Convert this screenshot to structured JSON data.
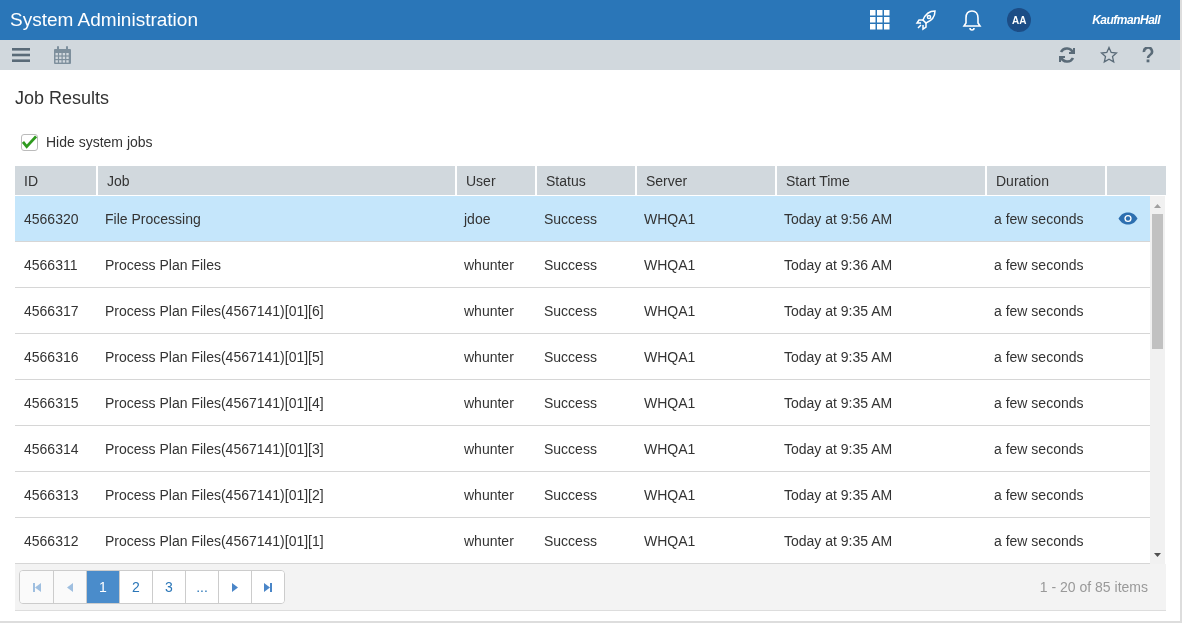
{
  "header": {
    "title": "System Administration",
    "avatar": "AA",
    "brand": "KaufmanHall"
  },
  "page": {
    "title": "Job Results",
    "hide_system_jobs": {
      "label": "Hide system jobs",
      "checked": true
    }
  },
  "table": {
    "columns": [
      "ID",
      "Job",
      "User",
      "Status",
      "Server",
      "Start Time",
      "Duration"
    ],
    "rows": [
      {
        "id": "4566320",
        "job": "File Processing",
        "user": "jdoe",
        "status": "Success",
        "server": "WHQA1",
        "start": "Today at 9:56 AM",
        "duration": "a few seconds",
        "selected": true
      },
      {
        "id": "4566311",
        "job": "Process Plan Files",
        "user": "whunter",
        "status": "Success",
        "server": "WHQA1",
        "start": "Today at 9:36 AM",
        "duration": "a few seconds",
        "selected": false
      },
      {
        "id": "4566317",
        "job": "Process Plan Files(4567141)[01][6]",
        "user": "whunter",
        "status": "Success",
        "server": "WHQA1",
        "start": "Today at 9:35 AM",
        "duration": "a few seconds",
        "selected": false
      },
      {
        "id": "4566316",
        "job": "Process Plan Files(4567141)[01][5]",
        "user": "whunter",
        "status": "Success",
        "server": "WHQA1",
        "start": "Today at 9:35 AM",
        "duration": "a few seconds",
        "selected": false
      },
      {
        "id": "4566315",
        "job": "Process Plan Files(4567141)[01][4]",
        "user": "whunter",
        "status": "Success",
        "server": "WHQA1",
        "start": "Today at 9:35 AM",
        "duration": "a few seconds",
        "selected": false
      },
      {
        "id": "4566314",
        "job": "Process Plan Files(4567141)[01][3]",
        "user": "whunter",
        "status": "Success",
        "server": "WHQA1",
        "start": "Today at 9:35 AM",
        "duration": "a few seconds",
        "selected": false
      },
      {
        "id": "4566313",
        "job": "Process Plan Files(4567141)[01][2]",
        "user": "whunter",
        "status": "Success",
        "server": "WHQA1",
        "start": "Today at 9:35 AM",
        "duration": "a few seconds",
        "selected": false
      },
      {
        "id": "4566312",
        "job": "Process Plan Files(4567141)[01][1]",
        "user": "whunter",
        "status": "Success",
        "server": "WHQA1",
        "start": "Today at 9:35 AM",
        "duration": "a few seconds",
        "selected": false
      }
    ]
  },
  "pager": {
    "buttons": [
      {
        "kind": "first"
      },
      {
        "kind": "prev"
      },
      {
        "kind": "page",
        "label": "1",
        "selected": true
      },
      {
        "kind": "page",
        "label": "2",
        "selected": false
      },
      {
        "kind": "page",
        "label": "3",
        "selected": false
      },
      {
        "kind": "page",
        "label": "...",
        "selected": false
      },
      {
        "kind": "next"
      },
      {
        "kind": "last"
      }
    ],
    "info": "1 - 20 of 85 items"
  }
}
